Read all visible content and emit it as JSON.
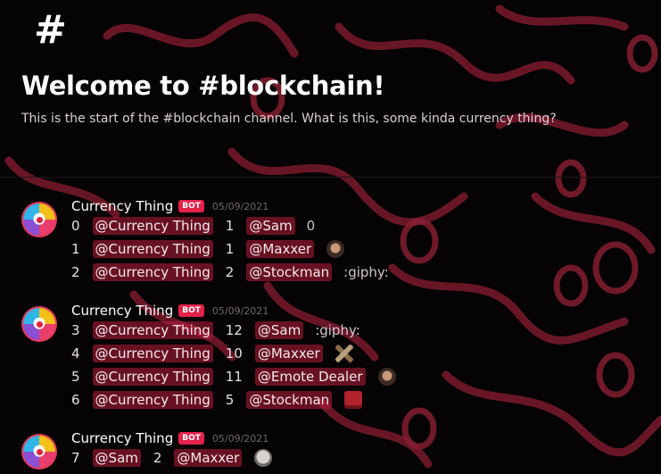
{
  "channel": {
    "hash_symbol": "#",
    "welcome_title": "Welcome to #blockchain!",
    "welcome_subtitle": "This is the start of the #blockchain channel. What is this, some kinda currency thing?"
  },
  "colors": {
    "background": "#050304",
    "accent_red": "#e4234b",
    "mention_bg": "#b91e3c"
  },
  "messages": [
    {
      "author": "Currency Thing",
      "badge": "BOT",
      "timestamp": "05/09/2021",
      "avatar_icon": "currency-thing-avatar",
      "lines": [
        {
          "rank": "0",
          "mention_a": "@Currency Thing",
          "score": "1",
          "mention_b": "@Sam",
          "extra_text": "0",
          "emoji": ""
        },
        {
          "rank": "1",
          "mention_a": "@Currency Thing",
          "score": "1",
          "mention_b": "@Maxxer",
          "extra_text": "",
          "emoji": "face-emoji"
        },
        {
          "rank": "2",
          "mention_a": "@Currency Thing",
          "score": "2",
          "mention_b": "@Stockman",
          "extra_text": ":giphy:",
          "emoji": ""
        }
      ]
    },
    {
      "author": "Currency Thing",
      "badge": "BOT",
      "timestamp": "05/09/2021",
      "avatar_icon": "currency-thing-avatar",
      "lines": [
        {
          "rank": "3",
          "mention_a": "@Currency Thing",
          "score": "12",
          "mention_b": "@Sam",
          "extra_text": ":giphy:",
          "emoji": ""
        },
        {
          "rank": "4",
          "mention_a": "@Currency Thing",
          "score": "10",
          "mention_b": "@Maxxer",
          "extra_text": "",
          "emoji": "plane-emoji"
        },
        {
          "rank": "5",
          "mention_a": "@Currency Thing",
          "score": "11",
          "mention_b": "@Emote Dealer",
          "extra_text": "",
          "emoji": "face-emoji"
        },
        {
          "rank": "6",
          "mention_a": "@Currency Thing",
          "score": "5",
          "mention_b": "@Stockman",
          "extra_text": "",
          "emoji": "box-emoji"
        }
      ]
    },
    {
      "author": "Currency Thing",
      "badge": "BOT",
      "timestamp": "05/09/2021",
      "avatar_icon": "currency-thing-avatar",
      "lines": [
        {
          "rank": "7",
          "mention_a": "@Sam",
          "score": "2",
          "mention_b": "@Maxxer",
          "extra_text": "",
          "emoji": "skull-emoji"
        }
      ]
    }
  ]
}
